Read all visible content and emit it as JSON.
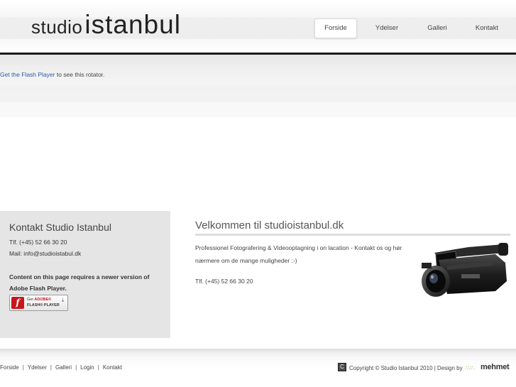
{
  "header": {
    "logo_small": "studio",
    "logo_big": "istanbul",
    "nav": [
      {
        "label": "Forside",
        "active": true
      },
      {
        "label": "Ydelser",
        "active": false
      },
      {
        "label": "Galleri",
        "active": false
      },
      {
        "label": "Kontakt",
        "active": false
      }
    ]
  },
  "rotator": {
    "link_text": "Get the Flash Player",
    "rest_text": " to see this rotator."
  },
  "sidebar": {
    "title": "Kontakt Studio Istanbul",
    "phone": "Tlf. (+45) 52 66 30 20",
    "mail": "Mail: info@studioistabul.dk",
    "flash_notice": "Content on this page requires a newer version of Adobe Flash Player.",
    "flash_badge": {
      "icon": "flash-player-icon",
      "line1_prefix": "Get ",
      "line1_brand": "ADOBE®",
      "line2": "FLASH® PLAYER"
    }
  },
  "main": {
    "title": "Velkommen til studioistanbul.dk",
    "body": "Professionel Fotografering & Videooptagning i on lacation - Kontakt os og hør nærmere om de mange muligheder :-)",
    "phone": "Tlf. (+45) 52 66 30 20",
    "image_icon": "video-camera-icon"
  },
  "footer": {
    "links": [
      "Forside",
      "Ydelser",
      "Galleri",
      "Login",
      "Kontakt"
    ],
    "separator": "|",
    "copyright_icon": "C",
    "copyright": "Copyright © Studio Istanbul 2010 | Design by",
    "designer": "mehmet"
  },
  "colors": {
    "header_rule": "#1a1a1a",
    "link": "#2a5aa8",
    "sidebar_bg": "#e5e5e5",
    "flash_red": "#c8161d",
    "designer_accent": "#7cb342"
  }
}
